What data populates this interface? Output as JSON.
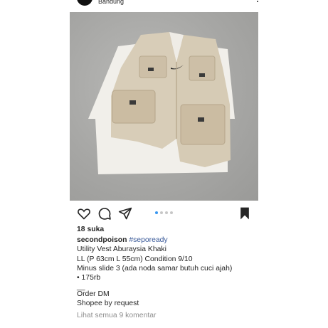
{
  "header": {
    "location": "Bandung"
  },
  "post": {
    "carousel": {
      "total": 4,
      "active": 1
    },
    "icons": [
      "heart-icon",
      "comment-icon",
      "share-icon",
      "bookmark-icon"
    ],
    "likes": "18 suka",
    "username": "secondpoison",
    "hashtag": "#sepoready",
    "lines": [
      "Utility Vest Aburaysia Khaki",
      "LL (P 63cm L 55cm) Condition 9/10",
      "Minus slide 3 (ada noda samar butuh cuci ajah)",
      "• 175rb",
      "__",
      "Order DM",
      "Shopee by request"
    ],
    "comments_link": "Lihat semua 9 komentar"
  }
}
